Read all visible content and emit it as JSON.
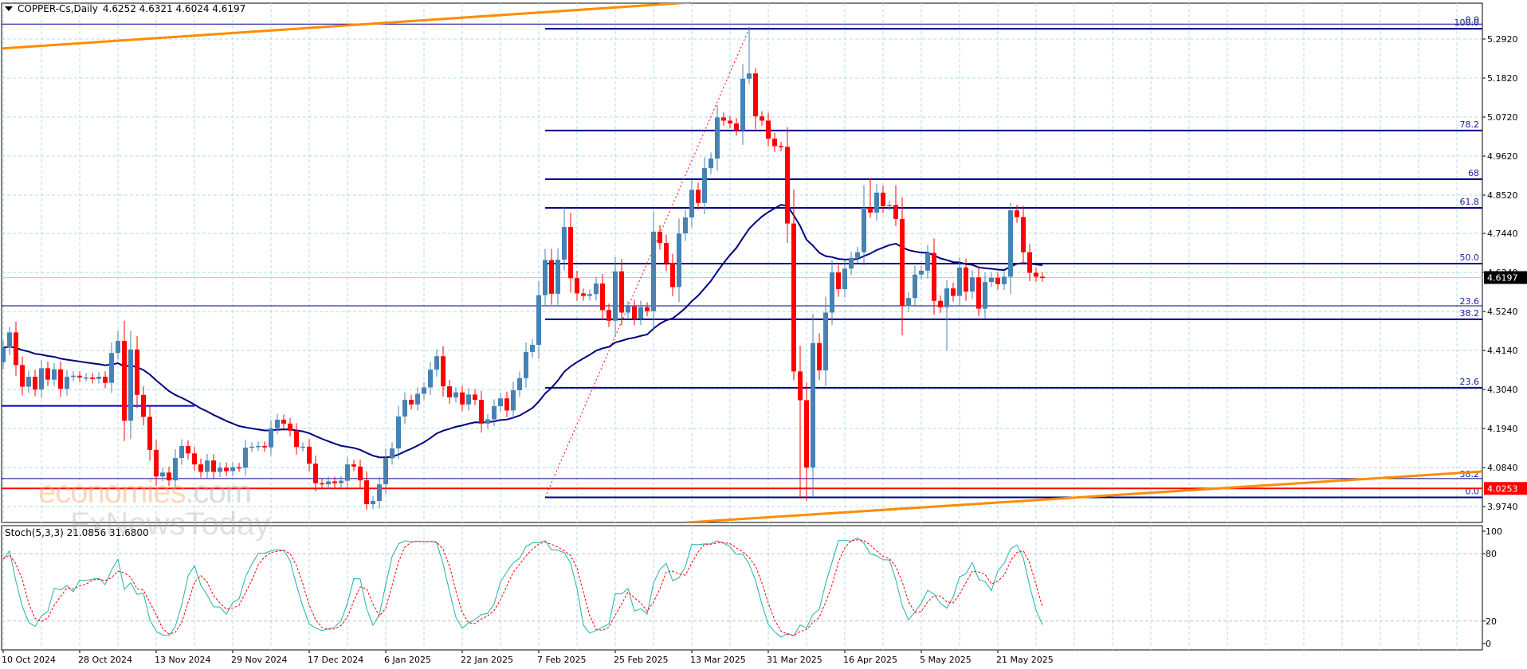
{
  "header": {
    "symbol": "COPPER-Cs,Daily",
    "ohlc": "4.6252 4.6321 4.6024 4.6197"
  },
  "stoch_label": "Stoch(5,3,3) 21.0856 31.6800",
  "watermark": {
    "brand1": "economies",
    "brand1_suffix": ".com",
    "brand2": "FxNewsToday"
  },
  "colors": {
    "bull": "#4682b4",
    "bear": "#ff0000",
    "fib": "#00008b",
    "ma": "#000080",
    "trend": "#ff8c00",
    "support": "#ff0000",
    "grid": "#b4dce0",
    "stoch_main": "#20b2aa",
    "stoch_signal": "#ff0000"
  },
  "chart_data": {
    "type": "candlestick",
    "title": "COPPER-Cs,Daily",
    "ylim": [
      3.93,
      5.39
    ],
    "y_ticks": [
      "5.2920",
      "5.1820",
      "5.0720",
      "4.9620",
      "4.8520",
      "4.7440",
      "4.6340",
      "4.5240",
      "4.4140",
      "4.3040",
      "4.1940",
      "4.0840",
      "3.9740"
    ],
    "x_labels": [
      {
        "bar": 0,
        "label": "10 Oct 2024"
      },
      {
        "bar": 12,
        "label": "28 Oct 2024"
      },
      {
        "bar": 24,
        "label": "13 Nov 2024"
      },
      {
        "bar": 36,
        "label": "29 Nov 2024"
      },
      {
        "bar": 48,
        "label": "17 Dec 2024"
      },
      {
        "bar": 60,
        "label": "6 Jan 2025"
      },
      {
        "bar": 72,
        "label": "22 Jan 2025"
      },
      {
        "bar": 84,
        "label": "7 Feb 2025"
      },
      {
        "bar": 96,
        "label": "25 Feb 2025"
      },
      {
        "bar": 108,
        "label": "13 Mar 2025"
      },
      {
        "bar": 120,
        "label": "31 Mar 2025"
      },
      {
        "bar": 132,
        "label": "16 Apr 2025"
      },
      {
        "bar": 144,
        "label": "5 May 2025"
      },
      {
        "bar": 156,
        "label": "21 May 2025"
      }
    ],
    "closes": [
      4.422,
      4.465,
      4.373,
      4.312,
      4.34,
      4.304,
      4.364,
      4.332,
      4.361,
      4.306,
      4.34,
      4.343,
      4.338,
      4.338,
      4.334,
      4.34,
      4.323,
      4.407,
      4.441,
      4.216,
      4.417,
      4.289,
      4.227,
      4.134,
      4.059,
      4.07,
      4.048,
      4.111,
      4.145,
      4.124,
      4.093,
      4.072,
      4.104,
      4.072,
      4.084,
      4.074,
      4.085,
      4.084,
      4.14,
      4.143,
      4.145,
      4.141,
      4.195,
      4.219,
      4.208,
      4.188,
      4.142,
      4.143,
      4.095,
      4.04,
      4.037,
      4.045,
      4.04,
      4.047,
      4.093,
      4.087,
      4.048,
      3.981,
      3.99,
      4.037,
      4.11,
      4.138,
      4.228,
      4.275,
      4.262,
      4.292,
      4.31,
      4.36,
      4.398,
      4.313,
      4.282,
      4.296,
      4.262,
      4.29,
      4.275,
      4.208,
      4.22,
      4.257,
      4.279,
      4.245,
      4.302,
      4.336,
      4.41,
      4.43,
      4.57,
      4.669,
      4.574,
      4.67,
      4.762,
      4.618,
      4.575,
      4.568,
      4.573,
      4.603,
      4.528,
      4.498,
      4.637,
      4.521,
      4.538,
      4.504,
      4.536,
      4.525,
      4.749,
      4.717,
      4.661,
      4.593,
      4.744,
      4.789,
      4.867,
      4.83,
      4.928,
      4.955,
      5.071,
      5.062,
      5.054,
      5.035,
      5.18,
      5.195,
      5.074,
      5.062,
      5.011,
      4.99,
      4.988,
      4.772,
      4.355,
      4.274,
      4.084,
      4.435,
      4.358,
      4.521,
      4.634,
      4.587,
      4.645,
      4.675,
      4.691,
      4.816,
      4.803,
      4.859,
      4.821,
      4.824,
      4.785,
      4.539,
      4.562,
      4.628,
      4.639,
      4.689,
      4.554,
      4.536,
      4.589,
      4.568,
      4.648,
      4.58,
      4.62,
      4.532,
      4.607,
      4.619,
      4.601,
      4.622,
      4.809,
      4.79,
      4.691,
      4.633,
      4.622,
      4.6197
    ],
    "first_open": 4.381,
    "high_overrides": {
      "1": 4.48,
      "18": 4.47,
      "88": 4.82,
      "117": 5.326,
      "118": 5.21,
      "125": 4.428,
      "135": 4.88,
      "136": 4.9,
      "140": 4.88,
      "146": 4.73,
      "158": 4.83
    },
    "low_overrides": {
      "57": 3.965,
      "124": 4.33,
      "125": 3.996,
      "126": 3.99,
      "141": 4.457,
      "148": 4.414,
      "153": 4.51
    },
    "moving_average": {
      "type": "EMA",
      "period": 34
    },
    "fib_main": {
      "start_bar": 85,
      "levels": [
        {
          "label": "100.0",
          "price": 5.321
        },
        {
          "label": "78.2",
          "price": 5.034
        },
        {
          "label": "68",
          "price": 4.897
        },
        {
          "label": "61.8",
          "price": 4.816
        },
        {
          "label": "50.0",
          "price": 4.659
        },
        {
          "label": "38.2",
          "price": 4.502
        },
        {
          "label": "23.6",
          "price": 4.309
        },
        {
          "label": "0.0",
          "price": 4.0
        }
      ]
    },
    "fib_secondary": {
      "levels": [
        {
          "label": "0.0",
          "price": 5.334
        },
        {
          "label": "23.6",
          "price": 4.54
        },
        {
          "label": "38.2",
          "price": 4.053
        }
      ]
    },
    "support_line": {
      "price": 4.0253,
      "label": "4.0253"
    },
    "current_price": {
      "price": 4.6197,
      "label": "4.6197"
    },
    "blue_segment": {
      "from_bar": 0,
      "to_bar": 30,
      "price": 4.258
    },
    "trendlines": [
      {
        "name": "upper",
        "points": [
          [
            -0.5,
            5.265
          ],
          [
            107.6,
            5.395
          ]
        ]
      },
      {
        "name": "lower",
        "points": [
          [
            107,
            3.929
          ],
          [
            232,
            4.073
          ]
        ]
      }
    ],
    "fib_dotted_line": {
      "points": [
        [
          85,
          4.0
        ],
        [
          117,
          5.321
        ]
      ]
    },
    "stochastic": {
      "k": 5,
      "d": 3,
      "slowing": 3,
      "levels": [
        20,
        80
      ],
      "ticks": [
        "100",
        "80",
        "20",
        "0"
      ],
      "ylim": [
        0,
        100
      ]
    }
  }
}
